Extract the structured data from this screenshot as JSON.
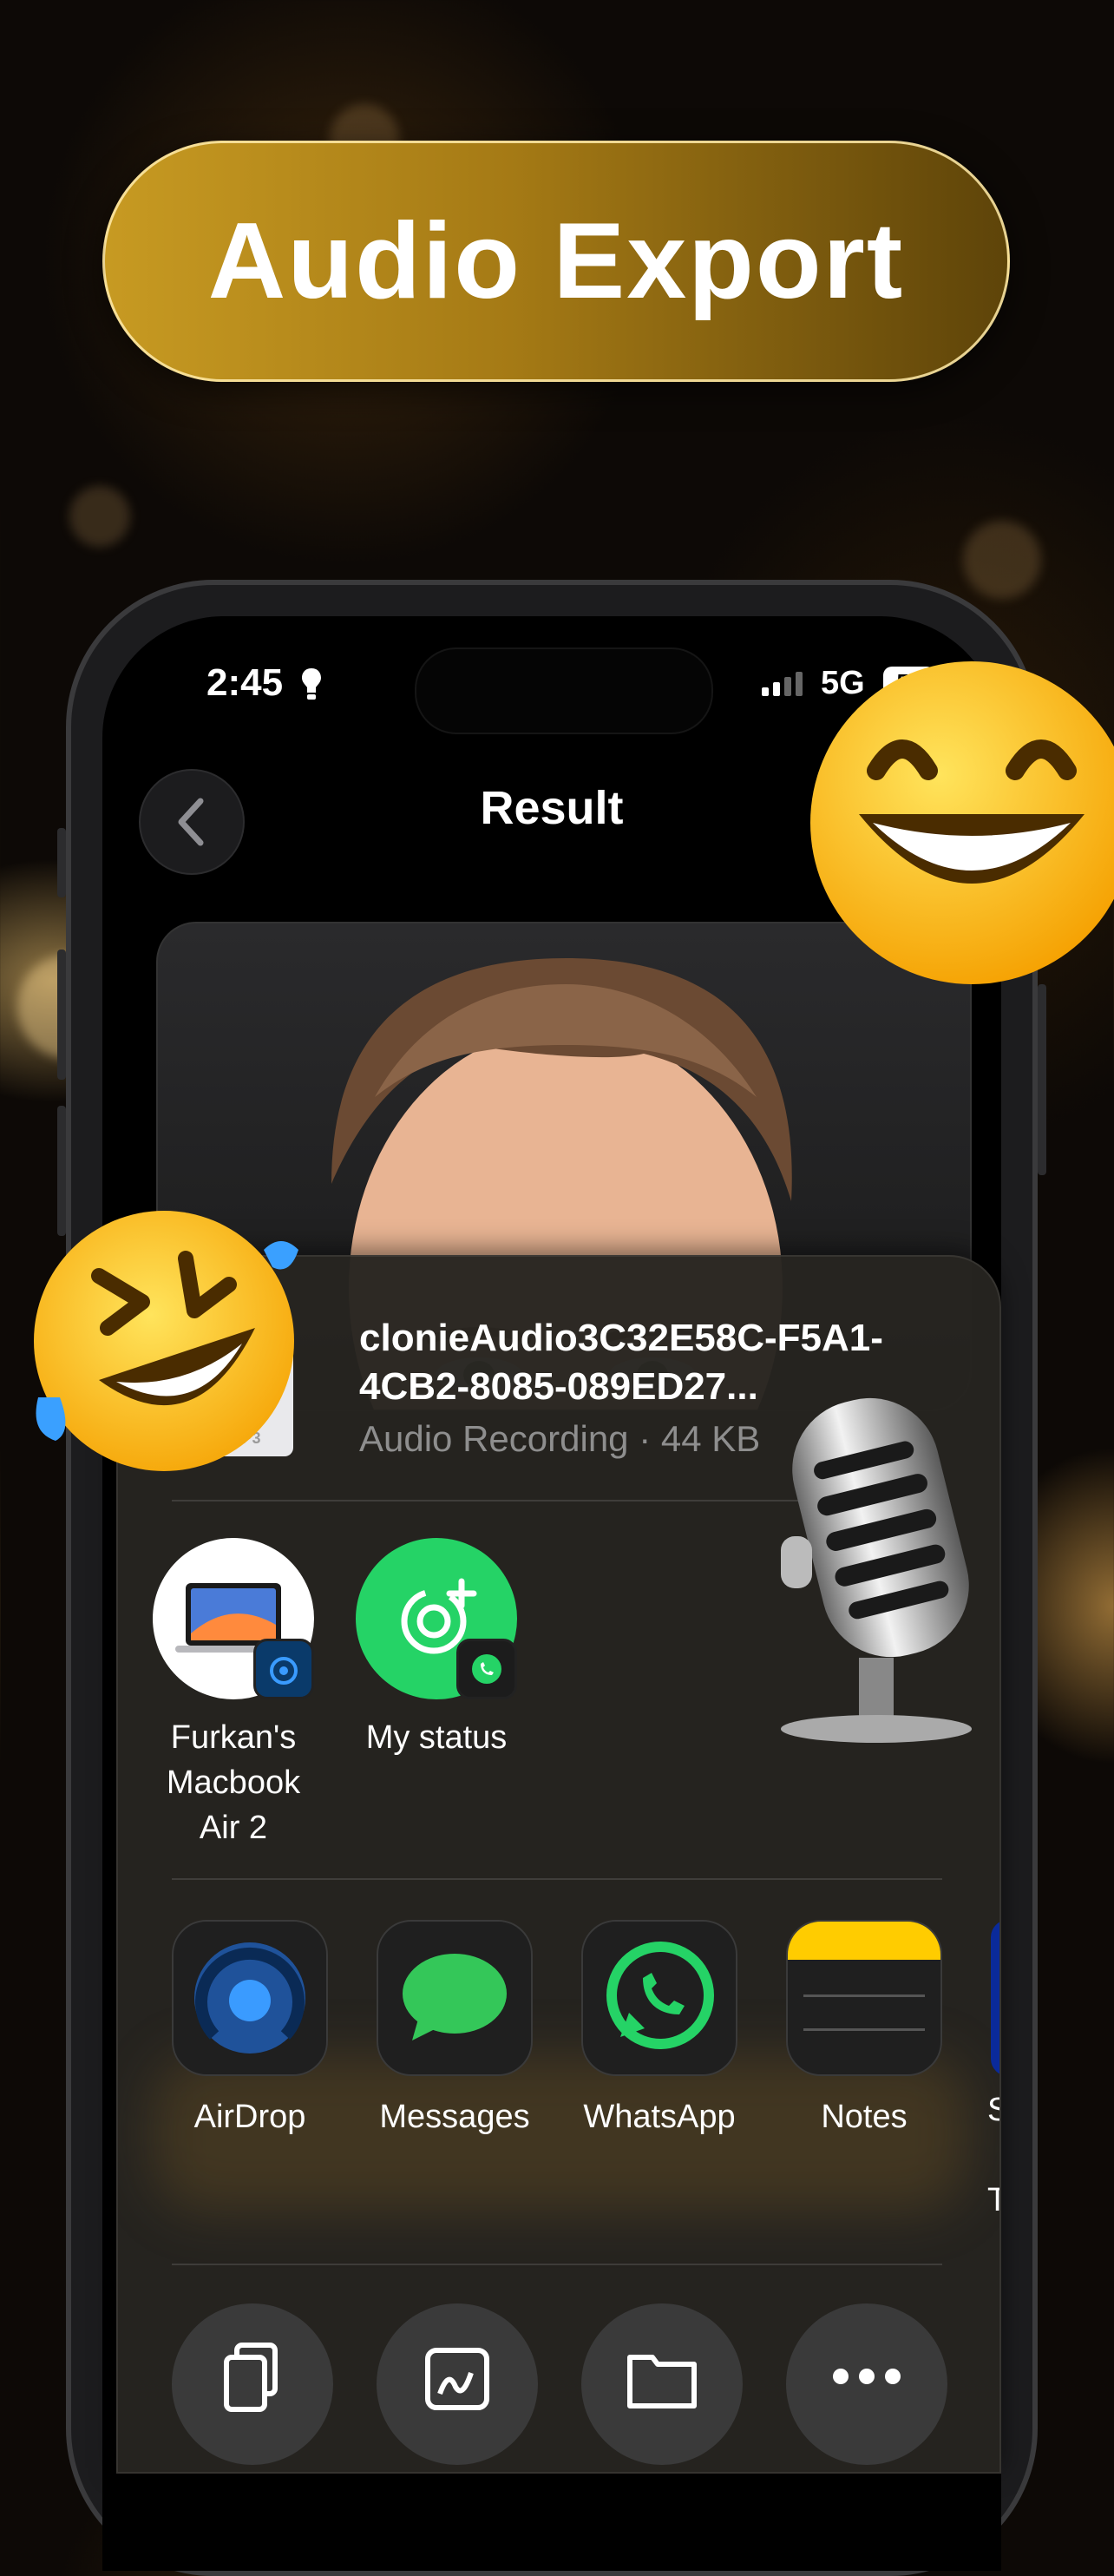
{
  "banner": {
    "title": "Audio Export"
  },
  "status_bar": {
    "time": "2:45",
    "network": "5G",
    "battery": "58"
  },
  "nav": {
    "title": "Result"
  },
  "share_sheet": {
    "file": {
      "type_label": "MP3",
      "name": "clonieAudio3C32E58C-F5A1-4CB2-8085-089ED27...",
      "meta": "Audio Recording · 44 KB"
    },
    "people": [
      {
        "label": "Furkan's Macbook Air 2"
      },
      {
        "label": "My status"
      }
    ],
    "apps": [
      {
        "label": "AirDrop"
      },
      {
        "label": "Messages"
      },
      {
        "label": "WhatsApp"
      },
      {
        "label": "Notes"
      }
    ],
    "partial_app": {
      "label_top": "S",
      "label_bottom": "T"
    }
  },
  "colors": {
    "banner_gold": "#c79a22",
    "whatsapp_green": "#25d366",
    "messages_green": "#34c759",
    "airdrop_blue": "#1f7cff",
    "notes_yellow": "#ffcc00"
  }
}
